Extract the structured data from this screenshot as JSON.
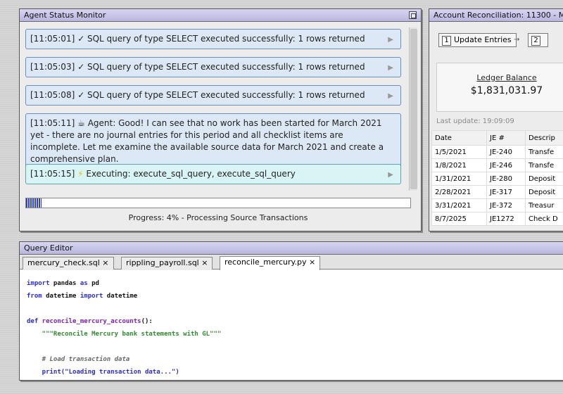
{
  "agent_monitor": {
    "title": "Agent Status Monitor",
    "messages": [
      {
        "time": "[11:05:01]",
        "icon": "✓",
        "text": "SQL query of type SELECT executed successfully: 1 rows returned"
      },
      {
        "time": "[11:05:03]",
        "icon": "✓",
        "text": "SQL query of type SELECT executed successfully: 1 rows returned"
      },
      {
        "time": "[11:05:08]",
        "icon": "✓",
        "text": "SQL query of type SELECT executed successfully: 1 rows returned"
      },
      {
        "time": "[11:05:11]",
        "icon": "☕",
        "text": "Agent: Good! I can see that no work has been started for March 2021 yet - there are no journal entries for this period and all checklist items are incomplete. Let me examine the available source data for March 2021 and create a comprehensive plan."
      },
      {
        "time": "[11:05:15]",
        "icon": "⚡",
        "text": "Executing: execute_sql_query, execute_sql_query"
      }
    ],
    "expand_arrow": "▶",
    "progress_fraction": 0.04,
    "progress_text": "Progress: 4% - Processing Source Transactions"
  },
  "account_window": {
    "title": "Account Reconciliation: 11300 - M",
    "steps": [
      {
        "num": "1",
        "label": "Update Entries"
      },
      {
        "num": "2",
        "label": ""
      }
    ],
    "step_arrow": "→",
    "balance_label": "Ledger Balance",
    "balance_value": "$1,831,031.97",
    "last_update": "Last update: 19:09:09",
    "table": {
      "headers": [
        "Date",
        "JE #",
        "Descrip"
      ],
      "rows": [
        [
          "1/5/2021",
          "JE-240",
          "Transfe"
        ],
        [
          "1/8/2021",
          "JE-246",
          "Transfe"
        ],
        [
          "1/31/2021",
          "JE-280",
          "Deposit"
        ],
        [
          "2/28/2021",
          "JE-317",
          "Deposit"
        ],
        [
          "3/31/2021",
          "JE-372",
          "Treasur"
        ],
        [
          "8/7/2025",
          "JE1272",
          "Check D"
        ]
      ]
    }
  },
  "query_editor": {
    "title": "Query Editor",
    "tabs": [
      {
        "label": "mercury_check.sql ×"
      },
      {
        "label": "rippling_payroll.sql ×"
      },
      {
        "label": "reconcile_mercury.py ×"
      }
    ],
    "code": {
      "l1_kw1": "import",
      "l1_mod": " pandas ",
      "l1_kw2": "as",
      "l1_alias": " pd",
      "l2_kw1": "from",
      "l2_mod": " datetime ",
      "l2_kw2": "import",
      "l2_name": " datetime",
      "l4_kw": "def",
      "l4_fn": " reconcile_mercury_accounts",
      "l4_rest": "():",
      "l5_doc": "    \"\"\"Reconcile Mercury bank statements with GL\"\"\"",
      "l7_cm": "    # Load transaction data",
      "l8": "    print(\"Loading transaction data...\")"
    }
  }
}
